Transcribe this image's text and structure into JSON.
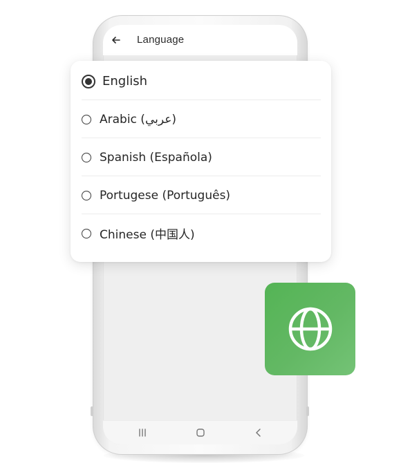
{
  "appbar": {
    "back_icon": "arrow-left-icon",
    "title": "Language"
  },
  "languages": {
    "selected_index": 0,
    "items": [
      {
        "label": "English"
      },
      {
        "label": "Arabic (عربي)"
      },
      {
        "label": "Spanish (Española)"
      },
      {
        "label": "Portugese (Português)"
      },
      {
        "label": "Chinese (中国人)"
      }
    ]
  },
  "navbar": {
    "icons": [
      "recent-apps-icon",
      "home-icon",
      "back-icon"
    ]
  },
  "badge": {
    "icon": "globe-icon",
    "color": "#5cb85c"
  }
}
